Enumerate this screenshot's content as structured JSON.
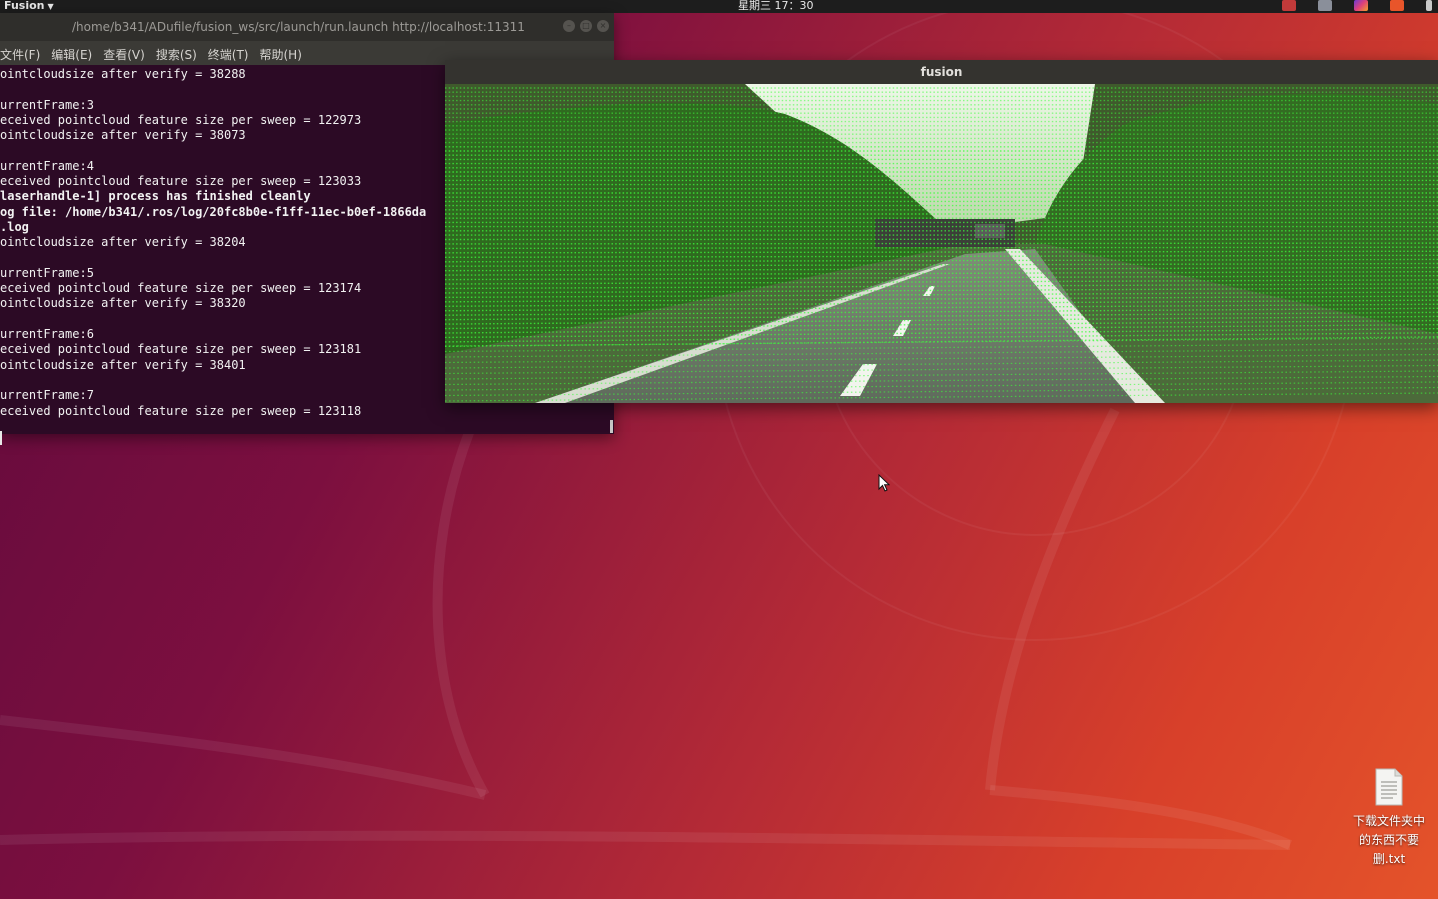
{
  "top_bar": {
    "app_menu": "Fusion",
    "clock": "星期三 17：30",
    "tray_icons": [
      "record-icon",
      "network-icon",
      "color-icon",
      "update-icon",
      "power-icon"
    ]
  },
  "terminal": {
    "title": "/home/b341/ADufile/fusion_ws/src/launch/run.launch http://localhost:11311",
    "menu": [
      "文件(F)",
      "编辑(E)",
      "查看(V)",
      "搜索(S)",
      "终端(T)",
      "帮助(H)"
    ],
    "lines": [
      {
        "text": "ointcloudsize after verify = 38288",
        "bold": false
      },
      {
        "text": "",
        "bold": false
      },
      {
        "text": "urrentFrame:3",
        "bold": false
      },
      {
        "text": "eceived pointcloud feature size per sweep = 122973",
        "bold": false
      },
      {
        "text": "ointcloudsize after verify = 38073",
        "bold": false
      },
      {
        "text": "",
        "bold": false
      },
      {
        "text": "urrentFrame:4",
        "bold": false
      },
      {
        "text": "eceived pointcloud feature size per sweep = 123033",
        "bold": false
      },
      {
        "text": "laserhandle-1] process has finished cleanly",
        "bold": true
      },
      {
        "text": "og file: /home/b341/.ros/log/20fc8b0e-f1ff-11ec-b0ef-1866da",
        "bold": true
      },
      {
        "text": ".log",
        "bold": true
      },
      {
        "text": "ointcloudsize after verify = 38204",
        "bold": false
      },
      {
        "text": "",
        "bold": false
      },
      {
        "text": "urrentFrame:5",
        "bold": false
      },
      {
        "text": "eceived pointcloud feature size per sweep = 123174",
        "bold": false
      },
      {
        "text": "ointcloudsize after verify = 38320",
        "bold": false
      },
      {
        "text": "",
        "bold": false
      },
      {
        "text": "urrentFrame:6",
        "bold": false
      },
      {
        "text": "eceived pointcloud feature size per sweep = 123181",
        "bold": false
      },
      {
        "text": "ointcloudsize after verify = 38401",
        "bold": false
      },
      {
        "text": "",
        "bold": false
      },
      {
        "text": "urrentFrame:7",
        "bold": false
      },
      {
        "text": "eceived pointcloud feature size per sweep = 123118",
        "bold": false
      }
    ]
  },
  "fusion_window": {
    "title": "fusion"
  },
  "desktop": {
    "icon_label": "下载文件夹中的东西不要删.txt"
  },
  "colors": {
    "terminal_bg": "#2c0a25",
    "lidar_point": "#3cff3c",
    "panel": "#1d1d1d"
  }
}
